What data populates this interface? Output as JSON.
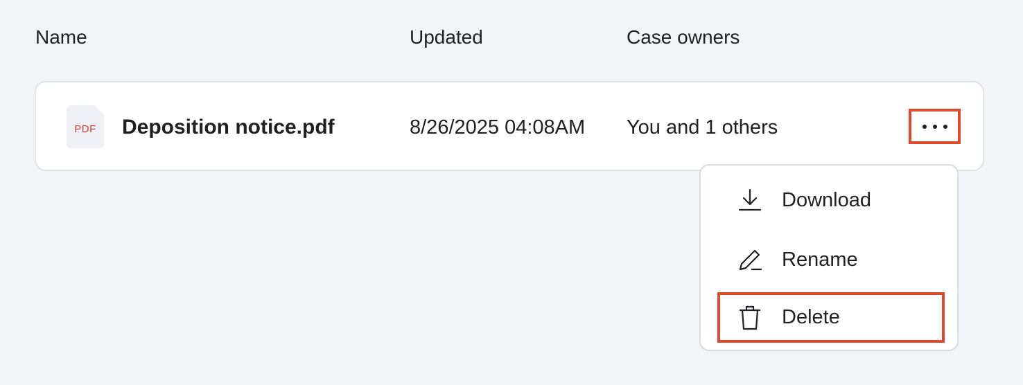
{
  "columns": {
    "name": "Name",
    "updated": "Updated",
    "owners": "Case owners"
  },
  "file": {
    "type_badge": "PDF",
    "name": "Deposition notice.pdf",
    "updated": "8/26/2025 04:08AM",
    "owners": "You and 1 others",
    "more_icon": "more-horizontal-icon"
  },
  "menu": {
    "items": [
      {
        "label": "Download",
        "icon": "download-icon"
      },
      {
        "label": "Rename",
        "icon": "pencil-icon"
      },
      {
        "label": "Delete",
        "icon": "trash-icon"
      }
    ]
  },
  "colors": {
    "highlight": "#e04a2c",
    "pdf_badge": "#d63b2f",
    "background": "#f3f4f8"
  }
}
